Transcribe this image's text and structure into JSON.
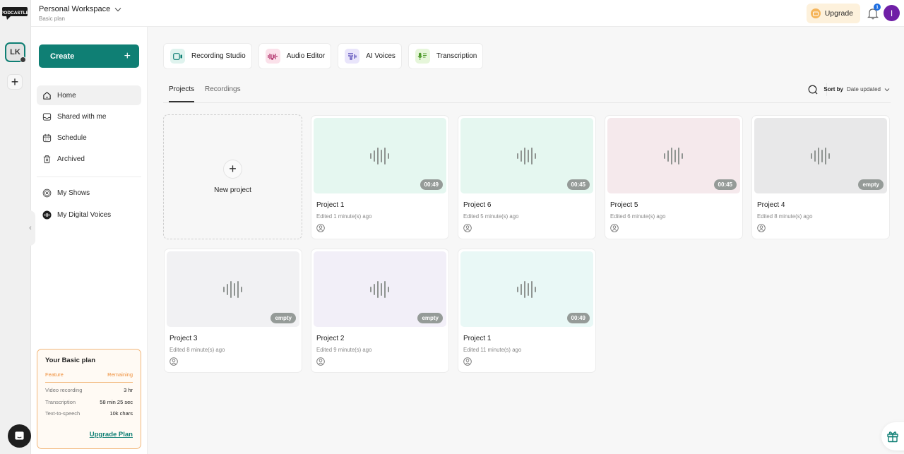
{
  "app": {
    "logo_text": "PODCASTLE"
  },
  "rail": {
    "workspace_initials": "LK",
    "add_label": "+"
  },
  "topbar": {
    "workspace_name": "Personal Workspace",
    "workspace_plan": "Basic plan",
    "upgrade_label": "Upgrade",
    "notification_count": "1",
    "user_initial": "I"
  },
  "sidebar": {
    "create_label": "Create",
    "create_icon": "+",
    "nav": [
      {
        "label": "Home",
        "icon": "home-icon",
        "active": true
      },
      {
        "label": "Shared with me",
        "icon": "inbox-icon"
      },
      {
        "label": "Schedule",
        "icon": "calendar-icon"
      },
      {
        "label": "Archived",
        "icon": "trash-icon"
      }
    ],
    "nav2": [
      {
        "label": "My Shows",
        "icon": "podcast-icon"
      },
      {
        "label": "My Digital Voices",
        "icon": "voice-icon"
      }
    ],
    "plan": {
      "title": "Your Basic plan",
      "col_feature": "Feature",
      "col_remaining": "Remaining",
      "rows": [
        {
          "feature": "Video recording",
          "remaining": "3 hr"
        },
        {
          "feature": "Transcription",
          "remaining": "58 min 25 sec"
        },
        {
          "feature": "Text-to-speech",
          "remaining": "10k chars"
        }
      ],
      "upgrade_link": "Upgrade Plan"
    }
  },
  "main": {
    "tools": [
      {
        "label": "Recording Studio",
        "icon": "camera-icon",
        "bg": "#dff3ee",
        "fg": "#0f7f74"
      },
      {
        "label": "Audio Editor",
        "icon": "audio-edit-icon",
        "bg": "#fbe1ea",
        "fg": "#b0306a"
      },
      {
        "label": "AI Voices",
        "icon": "ai-voice-icon",
        "bg": "#e9e5fb",
        "fg": "#4b3fb3"
      },
      {
        "label": "Transcription",
        "icon": "mic-text-icon",
        "bg": "#e6f6da",
        "fg": "#4d9a2a"
      }
    ],
    "tabs": [
      {
        "label": "Projects",
        "active": true
      },
      {
        "label": "Recordings"
      }
    ],
    "sort_by_label": "Sort by",
    "sort_value": "Date updated",
    "new_project_label": "New project",
    "projects": [
      {
        "title": "Project 1",
        "edited": "Edited 1 minute(s) ago",
        "duration": "00:49",
        "color": "#e5f7f0"
      },
      {
        "title": "Project 6",
        "edited": "Edited 5 minute(s) ago",
        "duration": "00:45",
        "color": "#e5f7f0"
      },
      {
        "title": "Project 5",
        "edited": "Edited 6 minute(s) ago",
        "duration": "00:45",
        "color": "#f5e9ec"
      },
      {
        "title": "Project 4",
        "edited": "Edited 8 minute(s) ago",
        "duration": "empty",
        "color": "#e8e8e9"
      },
      {
        "title": "Project 3",
        "edited": "Edited 8 minute(s) ago",
        "duration": "empty",
        "color": "#f1f1f3"
      },
      {
        "title": "Project 2",
        "edited": "Edited 9 minute(s) ago",
        "duration": "empty",
        "color": "#f2eff8"
      },
      {
        "title": "Project 1",
        "edited": "Edited 11 minute(s) ago",
        "duration": "00:49",
        "color": "#e9f8f6"
      }
    ]
  },
  "colors": {
    "accent": "#0f7f74",
    "plan_border": "#f2b77a",
    "upgrade_bg": "#fdf1dc",
    "avatar": "#6f1fa6"
  }
}
